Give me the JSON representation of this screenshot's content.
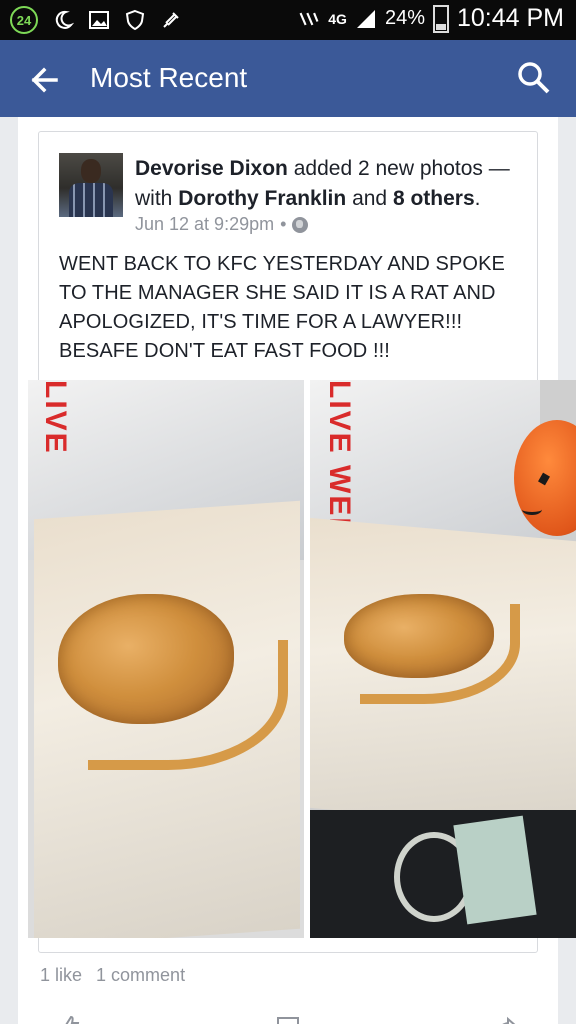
{
  "status_bar": {
    "notification_count": "24",
    "network": "4G",
    "battery": "24%",
    "battery_level": 0.24,
    "time": "10:44 PM",
    "icons": [
      "notification-badge-icon",
      "moon-icon",
      "image-icon",
      "shield-icon",
      "plug-icon",
      "nfc-icon",
      "signal-icon",
      "battery-icon"
    ]
  },
  "app_bar": {
    "title": "Most Recent",
    "back_icon": "arrow-left-icon",
    "search_icon": "search-icon"
  },
  "post": {
    "author": "Devorise Dixon",
    "action_text": "added 2 new photos —",
    "with_text": "with",
    "tagged_person": "Dorothy Franklin",
    "and_text": "and",
    "others": "8 others",
    "period": ".",
    "date": "Jun 12 at 9:29pm",
    "separator": "•",
    "privacy_icon": "globe-icon",
    "body": "WENT BACK TO KFC YESTERDAY AND SPOKE TO THE MANAGER SHE SAID IT IS A RAT AND APOLOGIZED, IT'S TIME FOR A LAWYER!!! BESAFE DON'T EAT FAST FOOD !!!",
    "photo_1_logo": "LIVE",
    "photo_2_logo": "LIVE WELL",
    "likes": "1 like",
    "comments": "1 comment"
  },
  "colors": {
    "app_bar": "#3b5998",
    "status_bar": "#0a0a0a",
    "feed_bg": "#e9ebee",
    "text_dark": "#1d2129",
    "text_meta": "#90949c"
  }
}
